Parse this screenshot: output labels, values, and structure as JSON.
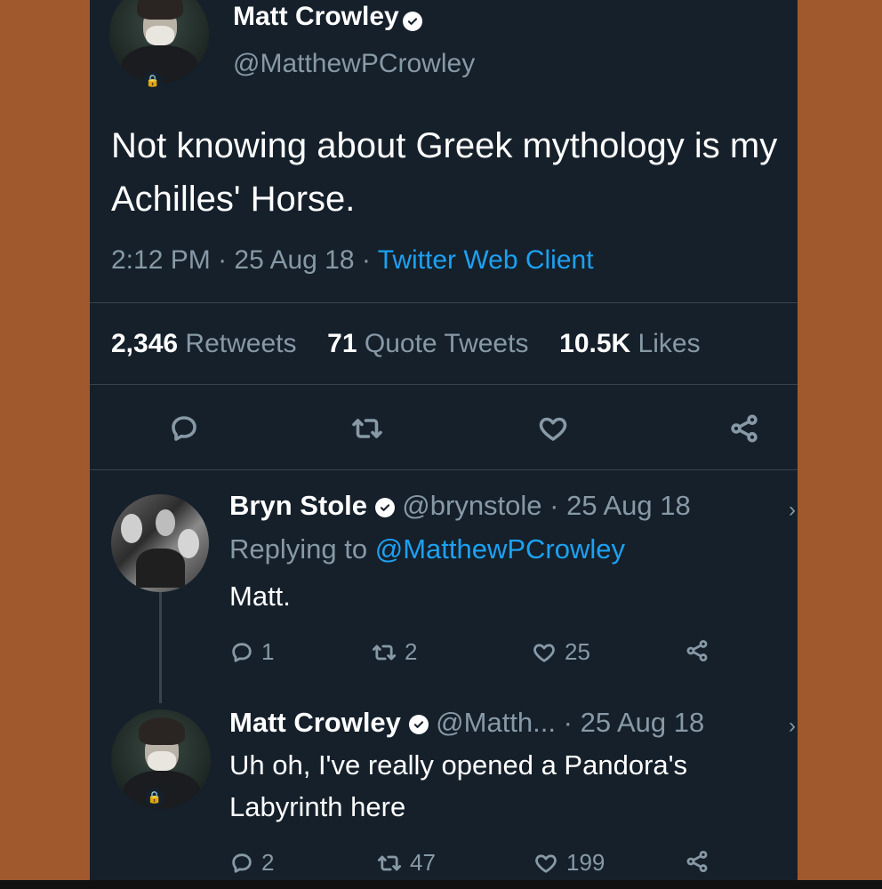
{
  "main_tweet": {
    "author_name": "Matt Crowley",
    "author_handle": "@MatthewPCrowley",
    "text": "Not knowing about Greek mythology is my Achilles' Horse.",
    "time": "2:12 PM",
    "date": "25 Aug 18",
    "source": "Twitter Web Client",
    "retweets_count": "2,346",
    "retweets_label": "Retweets",
    "quotes_count": "71",
    "quotes_label": "Quote Tweets",
    "likes_count": "10.5K",
    "likes_label": "Likes"
  },
  "actions": {
    "reply_icon": "reply-icon",
    "retweet_icon": "retweet-icon",
    "like_icon": "heart-icon",
    "share_icon": "share-icon"
  },
  "replies": [
    {
      "author_name": "Bryn Stole",
      "author_handle": "@brynstole",
      "date": "25 Aug 18",
      "replying_prefix": "Replying to",
      "replying_to": "@MatthewPCrowley",
      "text": "Matt.",
      "reply_count": "1",
      "retweet_count": "2",
      "like_count": "25"
    },
    {
      "author_name": "Matt Crowley",
      "author_handle": "@Matth...",
      "date": "25 Aug 18",
      "text_line1": "Uh oh, I've really opened a Pandora's",
      "text_line2": "Labyrinth here",
      "reply_count": "2",
      "retweet_count": "47",
      "like_count": "199"
    }
  ],
  "colors": {
    "background": "#15202b",
    "link": "#1da1f2",
    "muted": "#8899a6",
    "frame": "#a0592c"
  }
}
